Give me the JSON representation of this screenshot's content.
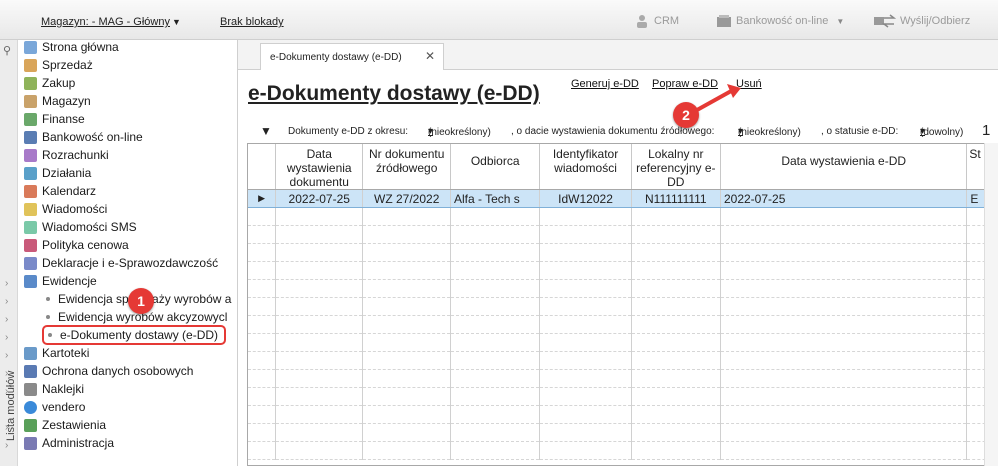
{
  "toolbar": {
    "warehouse": "Magazyn: - MAG - Główny",
    "lock_status": "Brak blokady",
    "crm": "CRM",
    "banking": "Bankowość on-line",
    "send": "Wyślij/Odbierz"
  },
  "sidebar": {
    "panel_label": "Lista modułów",
    "items": [
      {
        "label": "Strona główna",
        "icon": "home-icon"
      },
      {
        "label": "Sprzedaż",
        "icon": "sales-icon"
      },
      {
        "label": "Zakup",
        "icon": "cart-icon"
      },
      {
        "label": "Magazyn",
        "icon": "warehouse-icon"
      },
      {
        "label": "Finanse",
        "icon": "finance-icon"
      },
      {
        "label": "Bankowość on-line",
        "icon": "bank-icon"
      },
      {
        "label": "Rozrachunki",
        "icon": "settlements-icon"
      },
      {
        "label": "Działania",
        "icon": "actions-icon"
      },
      {
        "label": "Kalendarz",
        "icon": "calendar-icon"
      },
      {
        "label": "Wiadomości",
        "icon": "mail-icon"
      },
      {
        "label": "Wiadomości SMS",
        "icon": "sms-icon"
      },
      {
        "label": "Polityka cenowa",
        "icon": "pricing-icon"
      },
      {
        "label": "Deklaracje i e-Sprawozdawczość",
        "icon": "declaration-icon"
      },
      {
        "label": "Ewidencje",
        "icon": "registry-icon"
      }
    ],
    "sub_items": [
      {
        "label": "Ewidencja sprzedaży wyrobów a"
      },
      {
        "label": "Ewidencja wyrobów akcyzowycl"
      },
      {
        "label": "e-Dokumenty dostawy (e-DD)"
      }
    ],
    "items_after": [
      {
        "label": "Kartoteki",
        "icon": "cards-icon"
      },
      {
        "label": "Ochrona danych osobowych",
        "icon": "privacy-icon"
      },
      {
        "label": "Naklejki",
        "icon": "labels-icon"
      },
      {
        "label": "vendero",
        "icon": "vendero-icon"
      },
      {
        "label": "Zestawienia",
        "icon": "reports-icon"
      },
      {
        "label": "Administracja",
        "icon": "admin-icon"
      }
    ]
  },
  "tab": {
    "label": "e-Dokumenty dostawy (e-DD)"
  },
  "main": {
    "title": "e-Dokumenty dostawy (e-DD)",
    "links": {
      "generate": "Generuj e-DD",
      "fix": "Popraw e-DD",
      "delete": "Usuń"
    },
    "filters": {
      "period_label": "Dokumenty e-DD z okresu:",
      "period_value": "(nieokreślony)",
      "date_label": ", o dacie wystawienia dokumentu źródłowego:",
      "date_value": "(nieokreślony)",
      "status_label": ", o statusie e-DD:",
      "status_value": "(dowolny)",
      "trailing": "1"
    },
    "columns": [
      "Data wystawienia dokumentu",
      "Nr dokumentu źródłowego",
      "Odbiorca",
      "Identyfikator wiadomości",
      "Lokalny nr referencyjny e-DD",
      "Data wystawienia e-DD",
      "St"
    ],
    "rows": [
      [
        "2022-07-25",
        "WZ 27/2022",
        "Alfa - Tech s",
        "IdW12022",
        "N111111111",
        "2022-07-25",
        "E"
      ]
    ]
  },
  "annotations": {
    "step1": "1",
    "step2": "2"
  },
  "colors": {
    "highlight": "#e53935",
    "selection": "#cce4f7"
  }
}
